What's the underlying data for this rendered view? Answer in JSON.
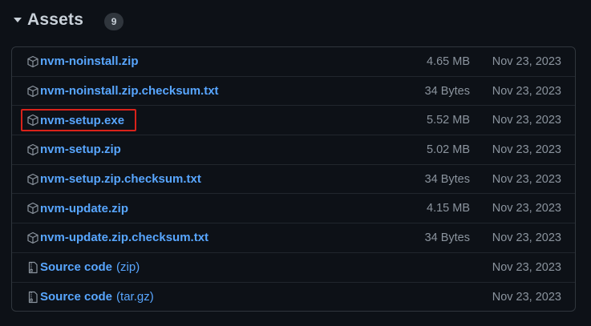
{
  "section": {
    "title": "Assets",
    "count": "9"
  },
  "assets": [
    {
      "name": "nvm-noinstall.zip",
      "suffix": "",
      "size": "4.65 MB",
      "date": "Nov 23, 2023",
      "icon": "package-icon"
    },
    {
      "name": "nvm-noinstall.zip.checksum.txt",
      "suffix": "",
      "size": "34 Bytes",
      "date": "Nov 23, 2023",
      "icon": "package-icon"
    },
    {
      "name": "nvm-setup.exe",
      "suffix": "",
      "size": "5.52 MB",
      "date": "Nov 23, 2023",
      "icon": "package-icon",
      "highlighted": true
    },
    {
      "name": "nvm-setup.zip",
      "suffix": "",
      "size": "5.02 MB",
      "date": "Nov 23, 2023",
      "icon": "package-icon"
    },
    {
      "name": "nvm-setup.zip.checksum.txt",
      "suffix": "",
      "size": "34 Bytes",
      "date": "Nov 23, 2023",
      "icon": "package-icon"
    },
    {
      "name": "nvm-update.zip",
      "suffix": "",
      "size": "4.15 MB",
      "date": "Nov 23, 2023",
      "icon": "package-icon"
    },
    {
      "name": "nvm-update.zip.checksum.txt",
      "suffix": "",
      "size": "34 Bytes",
      "date": "Nov 23, 2023",
      "icon": "package-icon"
    },
    {
      "name": "Source code",
      "suffix": "(zip)",
      "size": "",
      "date": "Nov 23, 2023",
      "icon": "file-zip-icon"
    },
    {
      "name": "Source code",
      "suffix": "(tar.gz)",
      "size": "",
      "date": "Nov 23, 2023",
      "icon": "file-zip-icon"
    }
  ],
  "colors": {
    "background": "#0d1117",
    "link": "#58a6ff",
    "muted": "#8b949e",
    "border": "#30363d",
    "highlight": "#d9221a"
  }
}
